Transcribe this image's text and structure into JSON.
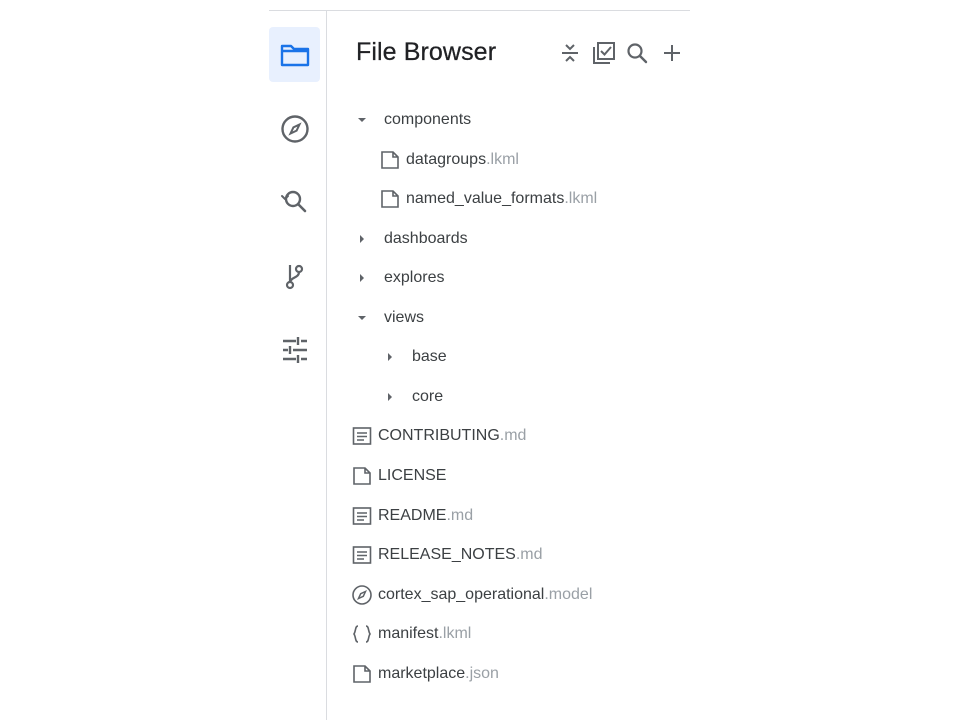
{
  "header": {
    "title": "File Browser",
    "tools": [
      {
        "icon": "collapse-all-icon"
      },
      {
        "icon": "select-checkbox-icon"
      },
      {
        "icon": "search-icon"
      },
      {
        "icon": "add-icon"
      }
    ]
  },
  "rail": {
    "items": [
      {
        "icon": "folder-icon",
        "active": true
      },
      {
        "icon": "explore-compass-icon",
        "active": false
      },
      {
        "icon": "search-history-icon",
        "active": false
      },
      {
        "icon": "git-branch-icon",
        "active": false
      },
      {
        "icon": "settings-sliders-icon",
        "active": false
      }
    ]
  },
  "tree": {
    "items": [
      {
        "name": "components",
        "ext": "",
        "kind": "folder",
        "expanded": true
      },
      {
        "name": "datagroups",
        "ext": ".lkml",
        "kind": "file"
      },
      {
        "name": "named_value_formats",
        "ext": ".lkml",
        "kind": "file"
      },
      {
        "name": "dashboards",
        "ext": "",
        "kind": "folder",
        "expanded": false
      },
      {
        "name": "explores",
        "ext": "",
        "kind": "folder",
        "expanded": false
      },
      {
        "name": "views",
        "ext": "",
        "kind": "folder",
        "expanded": true
      },
      {
        "name": "base",
        "ext": "",
        "kind": "folder",
        "expanded": false
      },
      {
        "name": "core",
        "ext": "",
        "kind": "folder",
        "expanded": false
      },
      {
        "name": "CONTRIBUTING",
        "ext": ".md",
        "kind": "doc"
      },
      {
        "name": "LICENSE",
        "ext": "",
        "kind": "file"
      },
      {
        "name": "README",
        "ext": ".md",
        "kind": "doc"
      },
      {
        "name": "RELEASE_NOTES",
        "ext": ".md",
        "kind": "doc"
      },
      {
        "name": "cortex_sap_operational",
        "ext": ".model",
        "kind": "model"
      },
      {
        "name": "manifest",
        "ext": ".lkml",
        "kind": "manifest"
      },
      {
        "name": "marketplace",
        "ext": ".json",
        "kind": "file"
      }
    ]
  },
  "colors": {
    "accent": "#1a73e8",
    "active_bg": "#e8f0fe",
    "icon": "#5f6368",
    "text": "#3c4043",
    "ext_text": "#9aa0a6"
  }
}
